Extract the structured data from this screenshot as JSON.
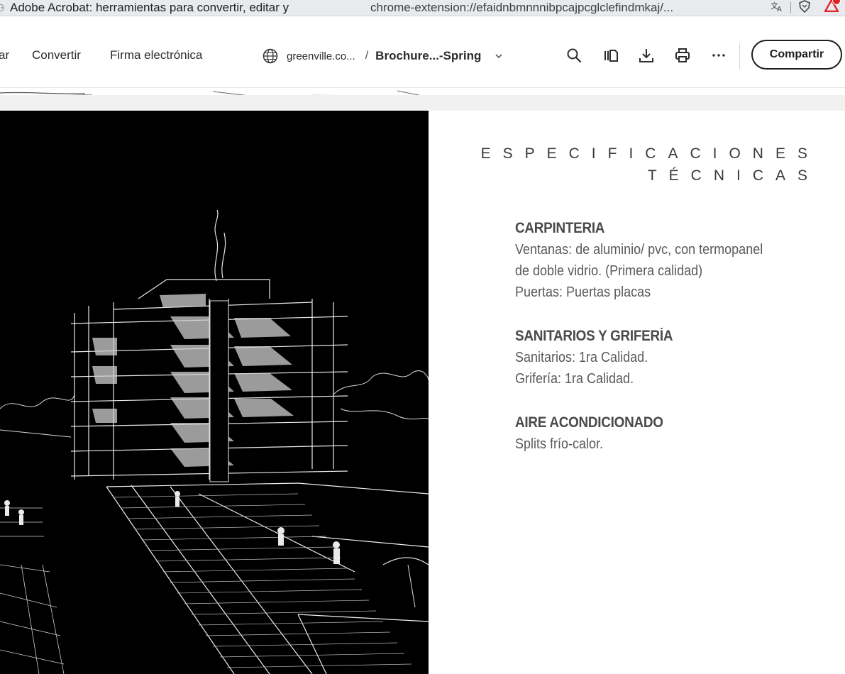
{
  "browser": {
    "tab_title": "Adobe Acrobat: herramientas para convertir, editar y",
    "address": "chrome-extension://efaidnbmnnnibpcajpcglclefindmkaj/...",
    "icons": [
      "translate-icon",
      "brave-shield-icon",
      "acrobat-extension-icon"
    ]
  },
  "toolbar": {
    "menu": [
      "ar",
      "Convertir",
      "Firma electrónica"
    ],
    "breadcrumb": {
      "domain": "greenville.co...",
      "separator": "/",
      "file": "Brochure...-Spring"
    },
    "tools": [
      "search-icon",
      "page-view-icon",
      "download-icon",
      "print-icon",
      "more-icon"
    ],
    "share_label": "Compartir"
  },
  "document": {
    "title_line1": "ESPECIFICACIONES",
    "title_line2": "TÉCNICAS",
    "sections": [
      {
        "heading": "CARPINTERIA",
        "lines": [
          "Ventanas: de aluminio/ pvc, con termopanel",
          "de doble vidrio. (Primera calidad)",
          "Puertas: Puertas placas"
        ]
      },
      {
        "heading": "SANITARIOS Y GRIFERÍA",
        "lines": [
          "Sanitarios: 1ra Calidad.",
          "Grifería: 1ra Calidad."
        ]
      },
      {
        "heading": "AIRE ACONDICIONADO",
        "lines": [
          "Splits frío-calor."
        ]
      }
    ]
  },
  "colors": {
    "accent_share_border": "#1e1e1e",
    "acrobat_red": "#e0242a",
    "sketch_background": "#000000",
    "heading_text": "#4a4a4a",
    "body_text": "#5a5a5a"
  }
}
